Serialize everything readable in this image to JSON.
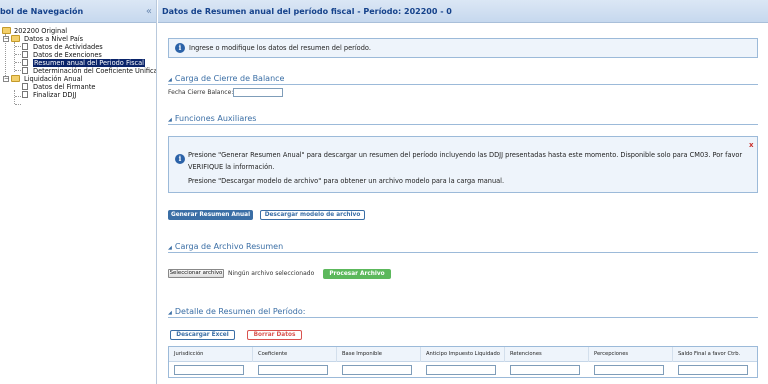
{
  "left_panel": {
    "title": "rbol de Navegación",
    "collapse": "«",
    "tree": {
      "root": "202200 Original",
      "group1": "Datos a Nivel País",
      "item_actividades": "Datos de Actividades",
      "item_exenciones": "Datos de Exenciones",
      "item_resumen": "Resumen anual del Periodo Fiscal",
      "item_coeficiente": "Determinación del Coeficiente Unifica",
      "group2": "Liquidación Anual",
      "item_firmante": "Datos del Firmante",
      "item_finalizar": "Finalizar DDJJ"
    }
  },
  "main": {
    "title": "Datos de Resumen anual del período fiscal - Período: 202200 - 0",
    "info_top": "Ingrese o modifique los datos del resumen del período.",
    "section_cierre": "Carga de Cierre de Balance",
    "fecha_label": "Fecha Cierre Balance:",
    "fecha_value": "",
    "section_funciones": "Funciones Auxiliares",
    "aux_line1": "Presione \"Generar Resumen Anual\" para descargar un resumen del período incluyendo las DDJJ presentadas hasta este momento. Disponible solo para CM03. Por favor",
    "aux_line2": "VERIFIQUE la información.",
    "aux_line3": "Presione \"Descargar modelo de archivo\" para obtener un archivo modelo para la carga manual.",
    "aux_close": "x",
    "btn_generar": "Generar Resumen Anual",
    "btn_modelo": "Descargar modelo de archivo",
    "section_archivo": "Carga de Archivo Resumen",
    "btn_seleccionar": "Seleccionar archivo",
    "file_status": "Ningún archivo seleccionado",
    "btn_procesar": "Procesar Archivo",
    "section_detalle": "Detalle de Resumen del Período:",
    "btn_excel": "Descargar Excel",
    "btn_borrar": "Borrar Datos",
    "table": {
      "columns": [
        "Jurisdicción",
        "Coeficiente",
        "Base Imponible",
        "Anticipo Impuesto Liquidado",
        "Retenciones",
        "Percepciones",
        "Saldo Final a favor Ctrb."
      ]
    }
  },
  "colors": {
    "primary": "#3a6ea5",
    "success": "#5cb85c",
    "danger": "#d9534f",
    "header_text": "#15428b",
    "selected_bg": "#0a246a"
  }
}
